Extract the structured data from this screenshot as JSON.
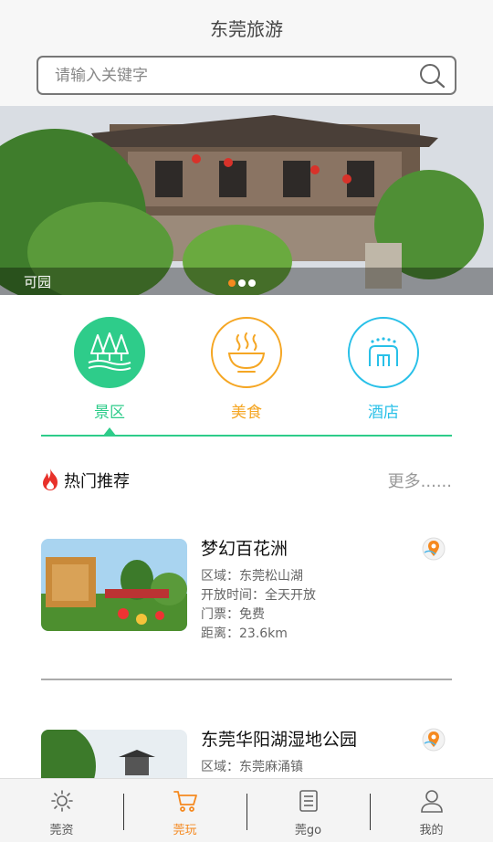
{
  "header": {
    "title": "东莞旅游"
  },
  "search": {
    "placeholder": "请输入关键字"
  },
  "banner": {
    "caption": "可园",
    "slide_count": 3,
    "active_slide": 1
  },
  "categories": [
    {
      "label": "景区",
      "icon": "trees-icon",
      "color": "#2ecc8a",
      "selected": true
    },
    {
      "label": "美食",
      "icon": "food-bowl-icon",
      "color": "#f5a623"
    },
    {
      "label": "酒店",
      "icon": "hotel-building-icon",
      "color": "#28c0e8"
    }
  ],
  "section": {
    "title": "热门推荐",
    "more": "更多......"
  },
  "items": [
    {
      "name": "梦幻百花洲",
      "region": "区域：东莞松山湖",
      "hours": "开放时间：全天开放",
      "ticket": "门票：免费",
      "distance": "距离：23.6km"
    },
    {
      "name": "东莞华阳湖湿地公园",
      "region": "区域：东莞麻涌镇"
    }
  ],
  "tabbar": [
    {
      "label": "莞资",
      "icon": "sun-icon",
      "active": false
    },
    {
      "label": "莞玩",
      "icon": "cart-icon",
      "active": true
    },
    {
      "label": "莞go",
      "icon": "list-icon",
      "active": false
    },
    {
      "label": "我的",
      "icon": "user-icon",
      "active": false
    }
  ],
  "colors": {
    "accent": "#f5891f",
    "green": "#2ecc8a",
    "orange": "#f5a623",
    "cyan": "#28c0e8"
  }
}
